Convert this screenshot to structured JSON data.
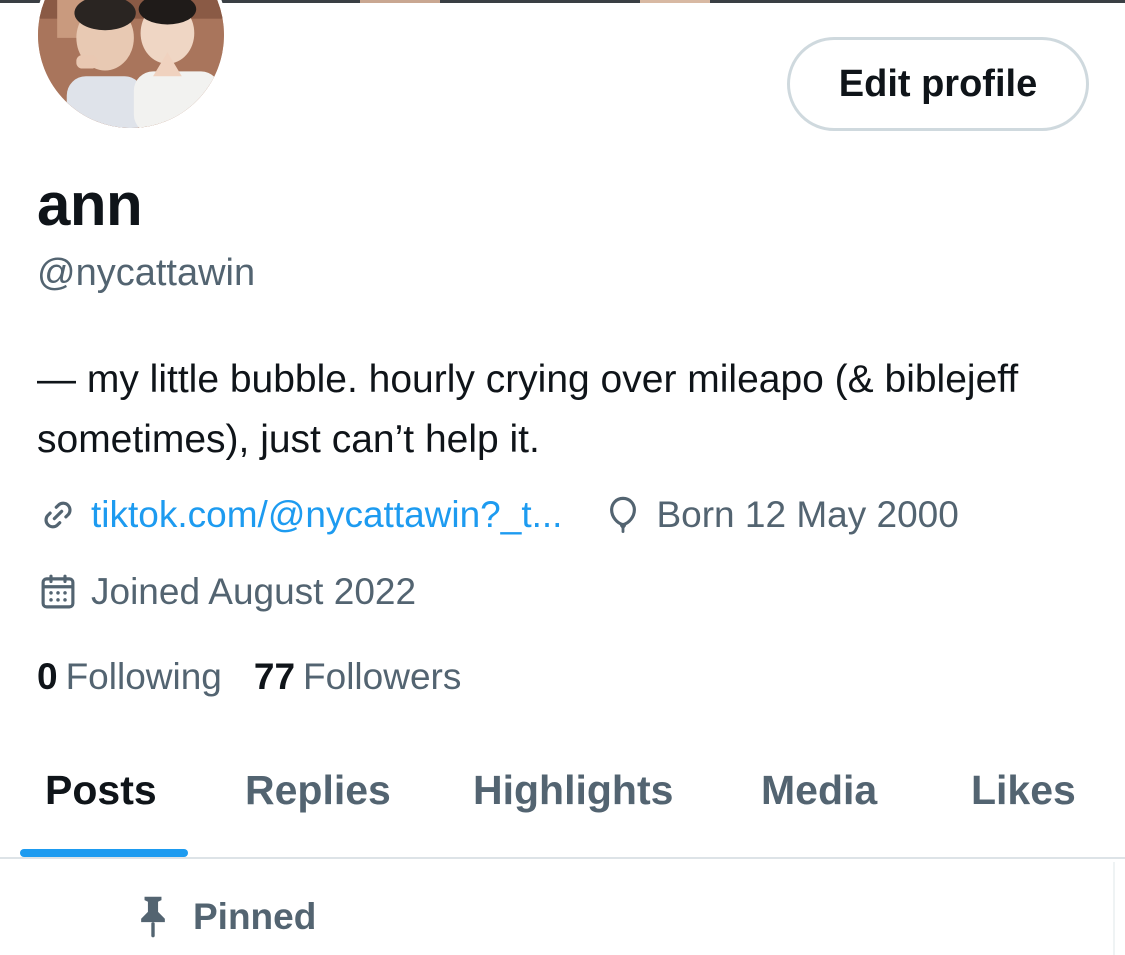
{
  "profile": {
    "display_name": "ann",
    "handle": "@nycattawin",
    "bio": "— my little bubble. hourly crying over mileapo (& biblejeff sometimes), just can’t help it.",
    "website": "tiktok.com/@nycattawin?_t...",
    "birthday": "Born 12 May 2000",
    "joined": "Joined August 2022",
    "following_count": "0",
    "following_label": "Following",
    "followers_count": "77",
    "followers_label": "Followers"
  },
  "actions": {
    "edit_profile_label": "Edit profile"
  },
  "tabs": [
    {
      "label": "Posts",
      "active": true
    },
    {
      "label": "Replies",
      "active": false
    },
    {
      "label": "Highlights",
      "active": false
    },
    {
      "label": "Media",
      "active": false
    },
    {
      "label": "Likes",
      "active": false
    }
  ],
  "feed": {
    "pinned_label": "Pinned"
  },
  "icons": {
    "link": "link-icon",
    "birthday": "balloon-icon",
    "joined": "calendar-icon",
    "pinned": "pin-icon"
  },
  "colors": {
    "accent": "#1d9bf0",
    "text_primary": "#0f1419",
    "text_secondary": "#536471",
    "border": "#cfd9de"
  }
}
